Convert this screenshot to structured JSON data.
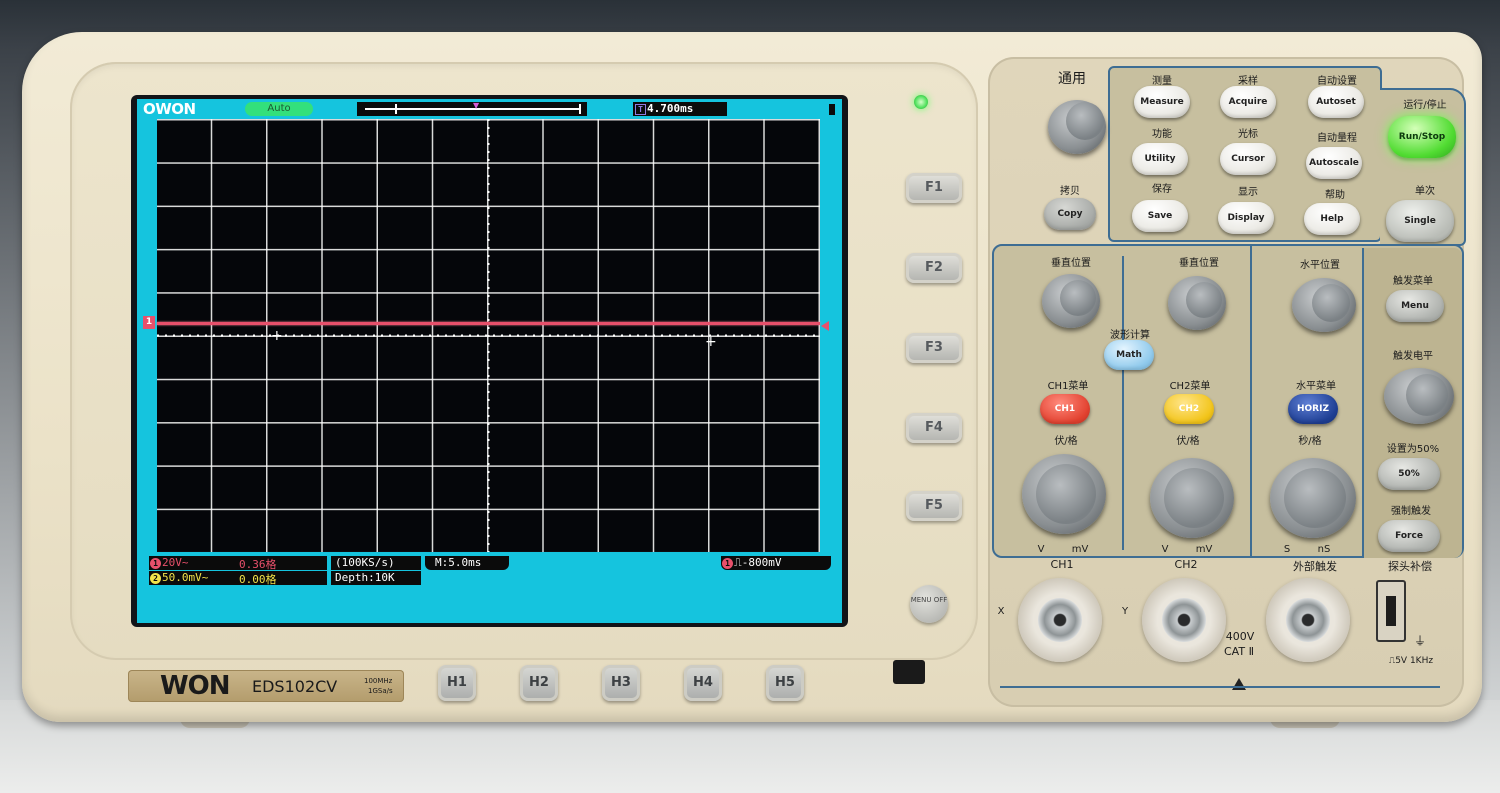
{
  "brand": {
    "screen_logo": "OWON",
    "badge_logo": "WON",
    "model": "EDS102CV",
    "spec_line1": "100MHz",
    "spec_line2": "1GSa/s"
  },
  "screen": {
    "run_state": "Auto",
    "trigger_time": "4.700ms",
    "ch1_label": "1",
    "ch1_scale": "20V~",
    "ch1_position": "0.36格",
    "ch2_scale": "50.0mV~",
    "ch2_position": "0.00格",
    "sample_rate": "(100KS/s)",
    "depth": "Depth:10K",
    "timebase": "M:5.0ms",
    "trigger_level": "-800mV",
    "trace_color": "#e8506b",
    "ch2_color": "#f2e24a",
    "lcd_bg": "#15c4de"
  },
  "function_buttons": [
    "F1",
    "F2",
    "F3",
    "F4",
    "F5"
  ],
  "menu_off_label": "MENU OFF",
  "h_buttons": [
    "H1",
    "H2",
    "H3",
    "H4",
    "H5"
  ],
  "panel": {
    "general_label": "通用",
    "copy_cn": "拷贝",
    "copy": "Copy",
    "measure_cn": "测量",
    "measure": "Measure",
    "acquire_cn": "采样",
    "acquire": "Acquire",
    "autoset_cn": "自动设置",
    "autoset": "Autoset",
    "utility_cn": "功能",
    "utility": "Utility",
    "cursor_cn": "光标",
    "cursor": "Cursor",
    "autoscale_cn": "自动量程",
    "autoscale": "Autoscale",
    "save_cn": "保存",
    "save": "Save",
    "display_cn": "显示",
    "display": "Display",
    "help_cn": "帮助",
    "help": "Help",
    "runstop_cn": "运行/停止",
    "runstop": "Run/Stop",
    "single_cn": "单次",
    "single": "Single",
    "vpos1_cn": "垂直位置",
    "vpos2_cn": "垂直位置",
    "hpos_cn": "水平位置",
    "math_cn": "波形计算",
    "math": "Math",
    "ch1_menu_cn": "CH1菜单",
    "ch1": "CH1",
    "ch2_menu_cn": "CH2菜单",
    "ch2": "CH2",
    "horiz_menu_cn": "水平菜单",
    "horiz": "HORIZ",
    "vdiv1_cn": "伏/格",
    "vdiv2_cn": "伏/格",
    "sdiv_cn": "秒/格",
    "v1": "V",
    "mv1": "mV",
    "v2": "V",
    "mv2": "mV",
    "s": "S",
    "ns": "nS",
    "trig_menu_cn": "触发菜单",
    "menu": "Menu",
    "trig_level_cn": "触发电平",
    "set50_cn": "设置为50%",
    "set50": "50%",
    "force_cn": "强制触发",
    "force": "Force"
  },
  "inputs": {
    "ch1": "CH1",
    "ch2": "CH2",
    "ext_trig_cn": "外部触发",
    "probe_comp_cn": "探头补偿",
    "x": "X",
    "y": "Y",
    "rating": "400V",
    "cat": "CAT Ⅱ",
    "probe_comp_signal": "⎍5V 1KHz"
  }
}
